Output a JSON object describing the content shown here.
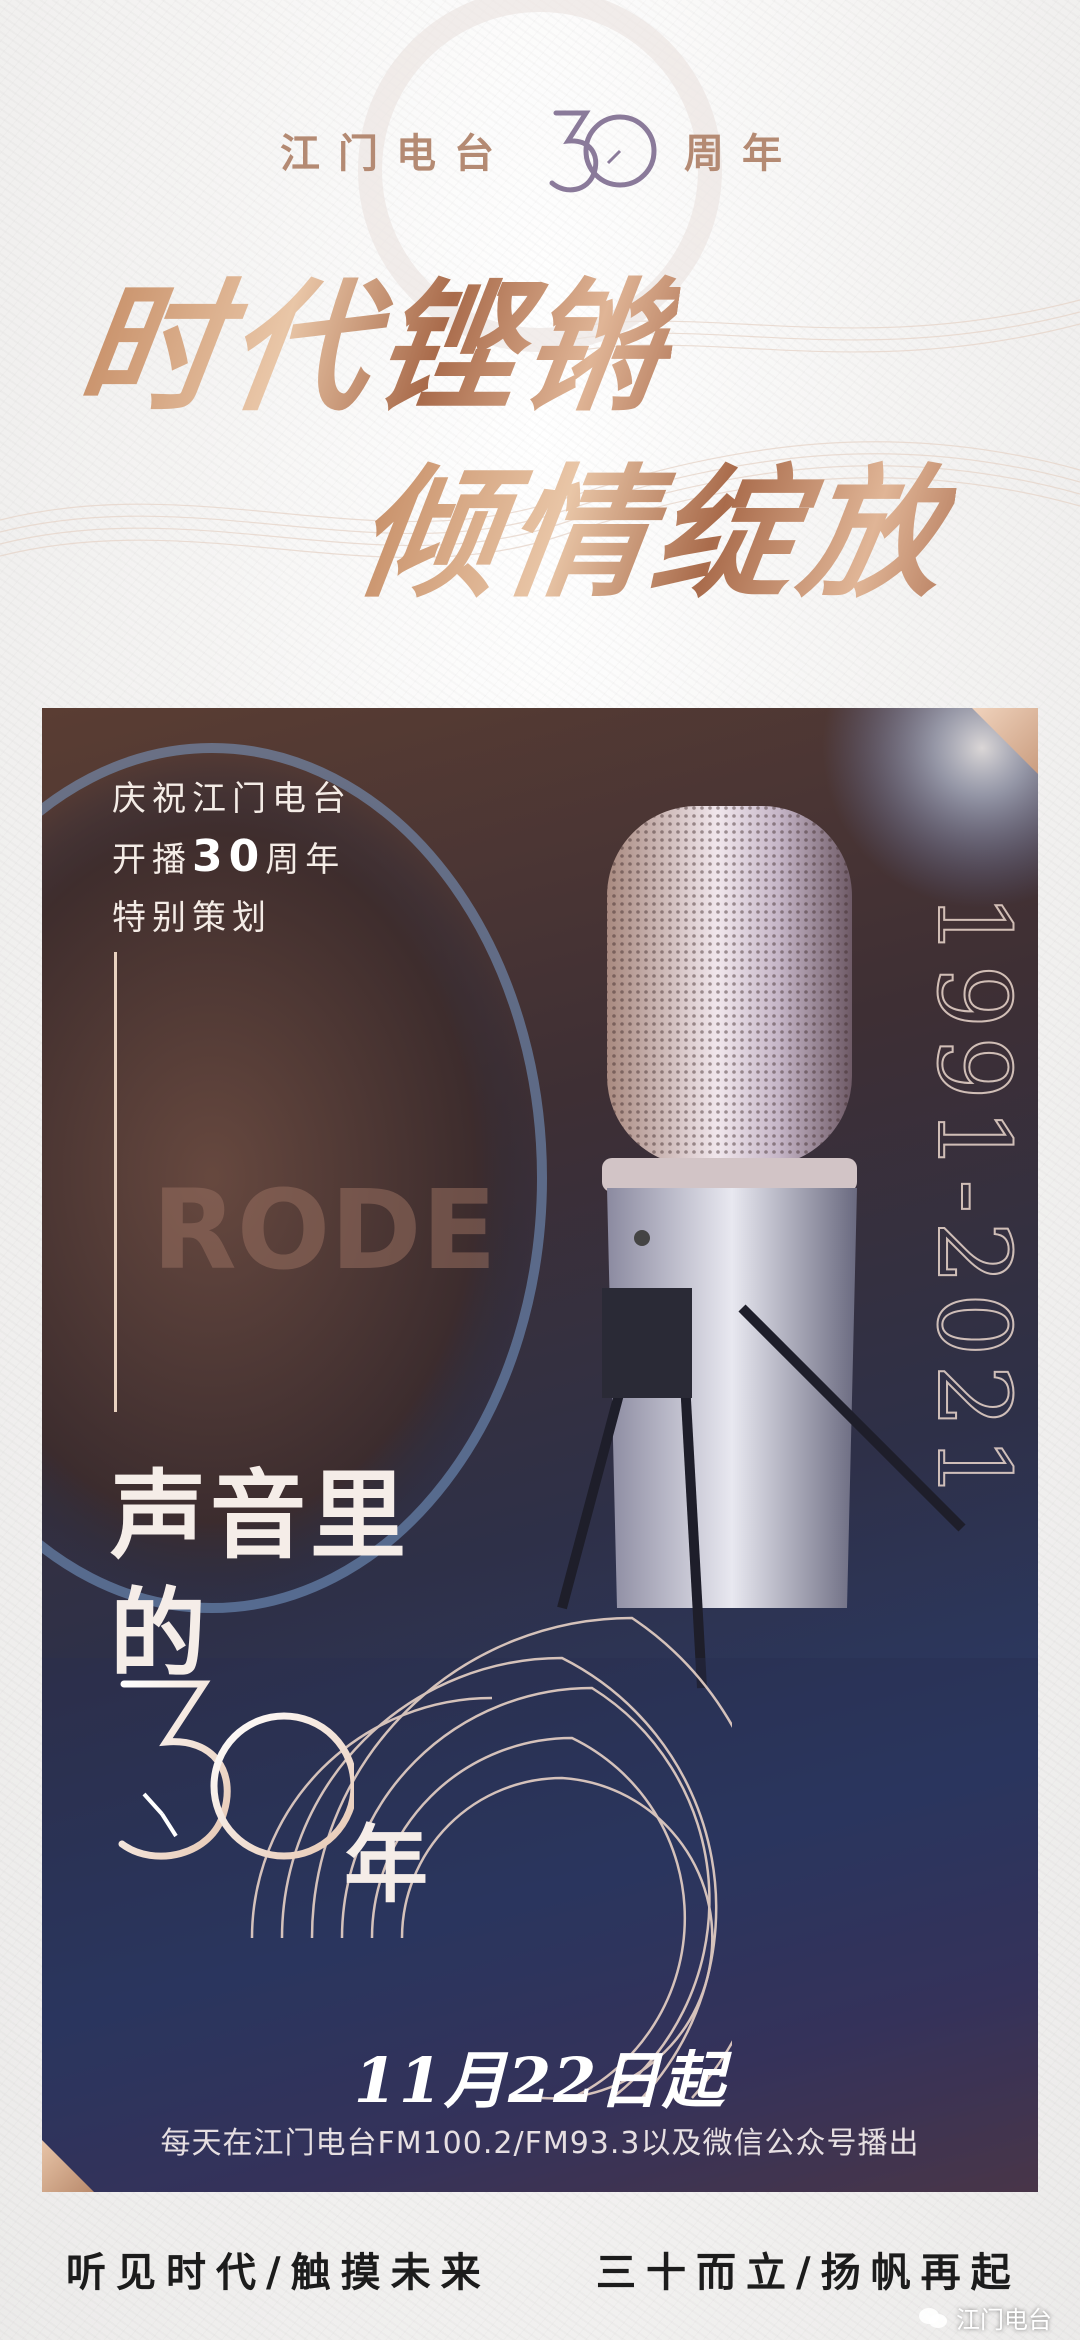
{
  "header": {
    "left_text": "江门电台",
    "right_text": "周年",
    "logo_number": "30"
  },
  "slogan": {
    "line1": "时代铿锵",
    "line2": "倾情绽放"
  },
  "poster": {
    "intro_line1": "庆祝江门电台",
    "intro_line2_prefix": "开播",
    "intro_line2_number": "30",
    "intro_line2_suffix": "周年",
    "intro_line3": "特别策划",
    "year_range": "1991-2021",
    "mic_brand": "RODE",
    "title_line1": "声音里",
    "title_line2": "的",
    "title_number": "30",
    "title_suffix": "年",
    "date": "11月22日起",
    "schedule": "每天在江门电台FM100.2/FM93.3以及微信公众号播出"
  },
  "footer": {
    "left": "听见时代/触摸未来",
    "right": "三十而立/扬帆再起"
  },
  "watermark": {
    "text": "江门电台"
  },
  "colors": {
    "gold": "#c89a7c",
    "card_blue": "#2b3a66",
    "card_brown": "#5a3d33"
  }
}
